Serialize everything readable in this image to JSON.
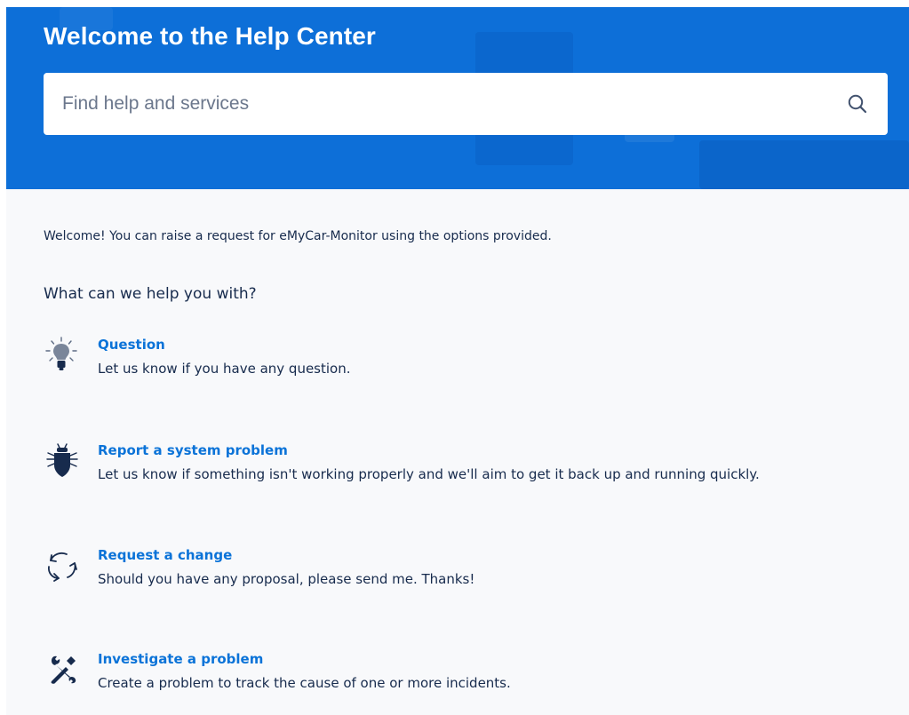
{
  "hero": {
    "title": "Welcome to the Help Center",
    "background_color": "#0d6fd8"
  },
  "search": {
    "placeholder": "Find help and services",
    "value": "",
    "icon": "search-icon"
  },
  "intro_text": "Welcome! You can raise a request for eMyCar-Monitor using the options provided.",
  "section_heading": "What can we help you with?",
  "link_color": "#0b73d8",
  "request_types": [
    {
      "title": "Question",
      "description": "Let us know if you have any question.",
      "icon": "lightbulb-icon"
    },
    {
      "title": "Report a system problem",
      "description": "Let us know if something isn't working properly and we'll aim to get it back up and running quickly.",
      "icon": "bug-icon"
    },
    {
      "title": "Request a change",
      "description": "Should you have any proposal, please send me. Thanks!",
      "icon": "refresh-arrows-icon"
    },
    {
      "title": "Investigate a problem",
      "description": "Create a problem to track the cause of one or more incidents.",
      "icon": "tools-icon"
    }
  ]
}
